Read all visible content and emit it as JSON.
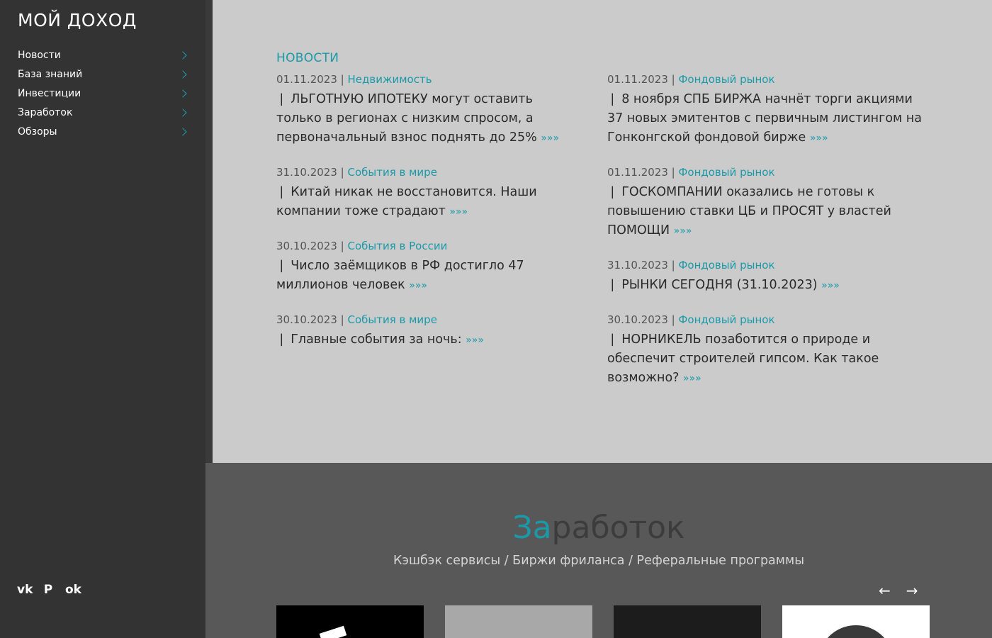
{
  "site": {
    "logo": "МОЙ ДОХОД"
  },
  "sidebar": {
    "items": [
      {
        "label": "Новости"
      },
      {
        "label": "База знаний"
      },
      {
        "label": "Инвестиции"
      },
      {
        "label": "Заработок"
      },
      {
        "label": "Обзоры"
      }
    ],
    "social": [
      "vk-icon",
      "pinterest-icon",
      "odnoklassniki-icon"
    ]
  },
  "news": {
    "heading": "НОВОСТИ",
    "more": "»»»",
    "left": [
      {
        "date": "01.11.2023",
        "category": "Недвижимость",
        "title": "❘ ЛЬГОТНУЮ ИПОТЕКУ могут оставить только в регионах с низким спросом, а первоначальный взнос поднять до 25%"
      },
      {
        "date": "31.10.2023",
        "category": "События в мире",
        "title": "❘ Китай никак не восстановится. Наши компании тоже страдают"
      },
      {
        "date": "30.10.2023",
        "category": "События в России",
        "title": "❘ Число заёмщиков в РФ достигло 47 миллионов человек"
      },
      {
        "date": "30.10.2023",
        "category": "События в мире",
        "title": "❘ Главные события за ночь:"
      }
    ],
    "right": [
      {
        "date": "01.11.2023",
        "category": "Фондовый рынок",
        "title": "❘ 8 ноября СПБ БИРЖА начнёт торги акциями 37 новых эмитентов с первичным листингом на Гонконгской фондовой бирже"
      },
      {
        "date": "01.11.2023",
        "category": "Фондовый рынок",
        "title": "❘ ГОСКОМПАНИИ оказались не готовы к повышению ставки ЦБ и ПРОСЯТ у властей ПОМОЩИ"
      },
      {
        "date": "31.10.2023",
        "category": "Фондовый рынок",
        "title": "❘ РЫНКИ СЕГОДНЯ (31.10.2023)"
      },
      {
        "date": "30.10.2023",
        "category": "Фондовый рынок",
        "title": "❘ НОРНИКЕЛЬ позаботится о природе и обеспечит строителей гипсом. Как такое возможно?"
      }
    ]
  },
  "earnings": {
    "title_accent": "За",
    "title_rest": "работок",
    "subtitle": "Кэшбэк сервисы / Биржи фриланса / Реферальные программы",
    "prev_arrow": "←",
    "next_arrow": "→"
  },
  "colors": {
    "accent": "#1a9aa8",
    "sidebar_bg": "#333333",
    "news_bg": "#cbcbcb",
    "earn_bg": "#585858"
  }
}
